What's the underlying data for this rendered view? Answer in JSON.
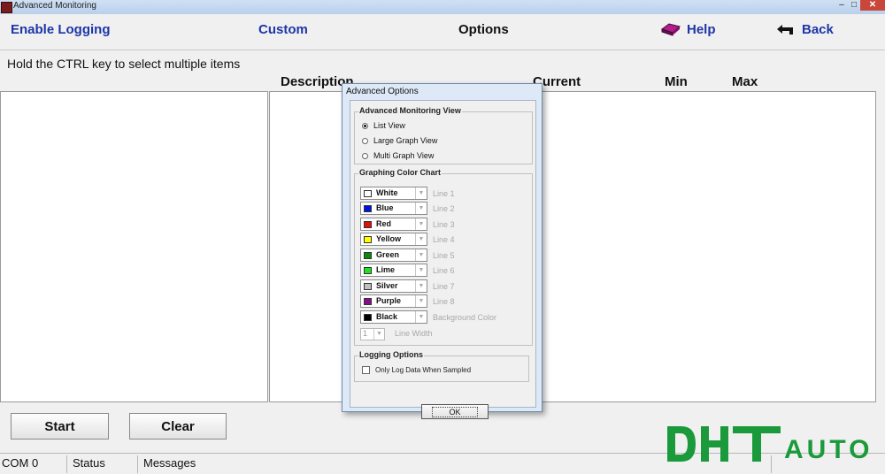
{
  "window": {
    "title": "Advanced Monitoring"
  },
  "menu": {
    "enable_logging": "Enable Logging",
    "custom": "Custom",
    "options": "Options",
    "help": "Help",
    "back": "Back"
  },
  "hint": "Hold the CTRL key to select multiple items",
  "columns": {
    "description": "Description",
    "current": "Current",
    "min": "Min",
    "max": "Max"
  },
  "buttons": {
    "start": "Start",
    "clear": "Clear"
  },
  "status": {
    "port": "COM 0",
    "status": "Status",
    "messages": "Messages"
  },
  "dialog": {
    "title": "Advanced Options",
    "view_group": "Advanced  Monitoring View",
    "views": [
      {
        "label": "List View",
        "selected": true
      },
      {
        "label": "Large Graph View",
        "selected": false
      },
      {
        "label": "Multi Graph View",
        "selected": false
      }
    ],
    "color_group": "Graphing Color Chart",
    "colors": [
      {
        "name": "White",
        "hex": "#ffffff",
        "target": "Line 1"
      },
      {
        "name": "Blue",
        "hex": "#0014e0",
        "target": "Line 2"
      },
      {
        "name": "Red",
        "hex": "#e01010",
        "target": "Line 3"
      },
      {
        "name": "Yellow",
        "hex": "#ffff00",
        "target": "Line 4"
      },
      {
        "name": "Green",
        "hex": "#0a8a0a",
        "target": "Line 5"
      },
      {
        "name": "Lime",
        "hex": "#22e022",
        "target": "Line 6"
      },
      {
        "name": "Silver",
        "hex": "#c0c0c0",
        "target": "Line 7"
      },
      {
        "name": "Purple",
        "hex": "#8a0a8a",
        "target": "Line 8"
      },
      {
        "name": "Black",
        "hex": "#000000",
        "target": "Background Color"
      }
    ],
    "line_width": {
      "value": "1",
      "label": "Line Width"
    },
    "logging_group": "Logging Options",
    "only_log": {
      "label": "Only Log Data When Sampled",
      "checked": false
    },
    "ok": "OK"
  },
  "logo": {
    "text": "DHTAUTO",
    "primary": "#1a9a3a",
    "secondary": "#2a3a9a"
  }
}
